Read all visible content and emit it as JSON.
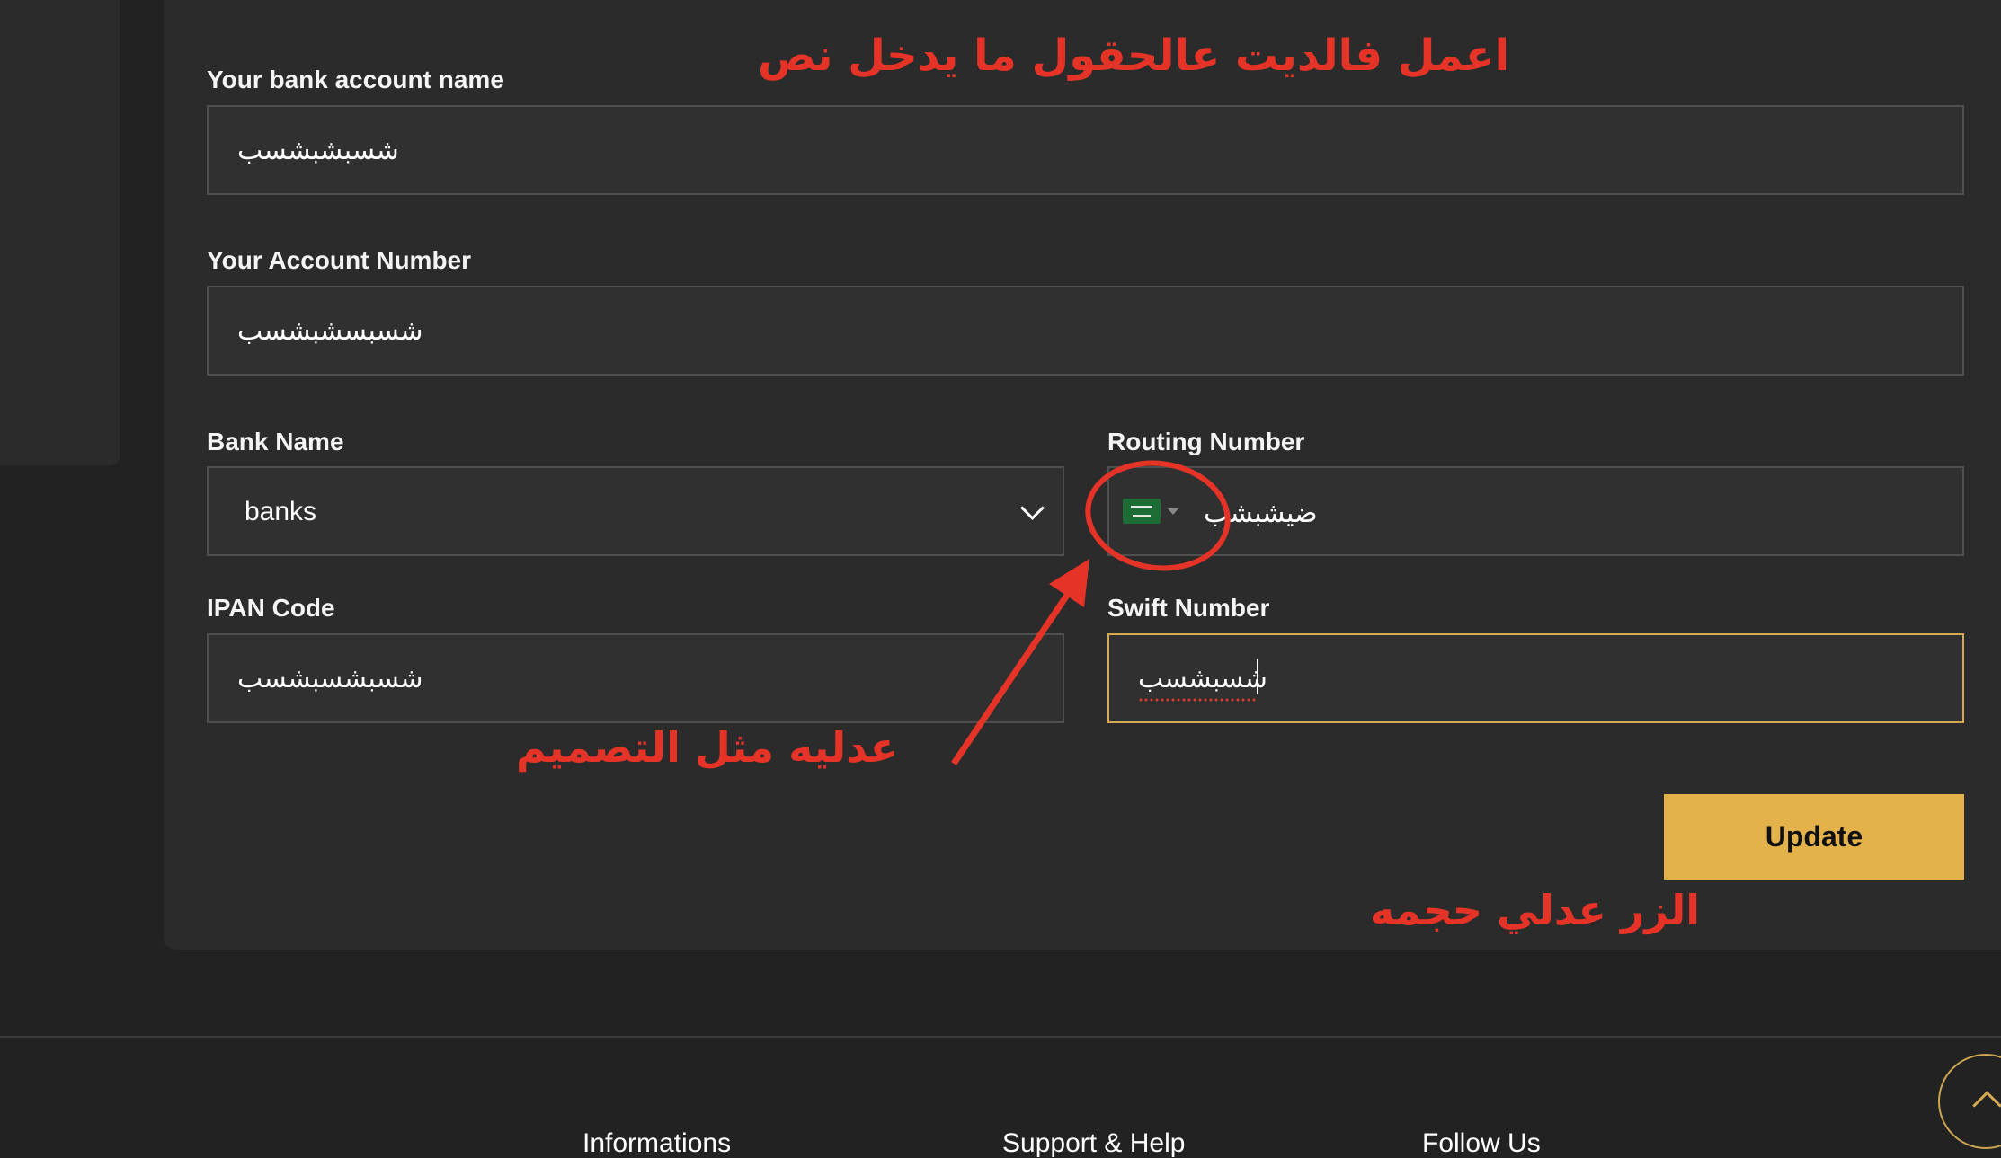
{
  "form": {
    "bank_account_name": {
      "label": "Your bank account name",
      "value": "شسبشبشسب"
    },
    "account_number": {
      "label": "Your Account Number",
      "value": "شسبسشبشسب"
    },
    "bank_name": {
      "label": "Bank Name",
      "value": "banks"
    },
    "routing_number": {
      "label": "Routing Number",
      "value": "ضيشبشب",
      "country_flag": "saudi-arabia-flag-icon"
    },
    "ipan_code": {
      "label": "IPAN Code",
      "value": "شسبشسبشسب"
    },
    "swift_number": {
      "label": "Swift Number",
      "value": "شسبشسب"
    },
    "update_label": "Update"
  },
  "annotations": {
    "top_note": "اعمل فالديت عالحقول ما يدخل نص",
    "design_note": "عدليه مثل التصميم",
    "button_note": "الزر عدلي حجمه",
    "color": "#e53427"
  },
  "footer": {
    "headings": [
      "Informations",
      "Support & Help",
      "Follow Us"
    ]
  },
  "colors": {
    "background": "#222222",
    "card": "#2b2b2b",
    "accent": "#e3b24b",
    "focus_border": "#d4aa52"
  }
}
